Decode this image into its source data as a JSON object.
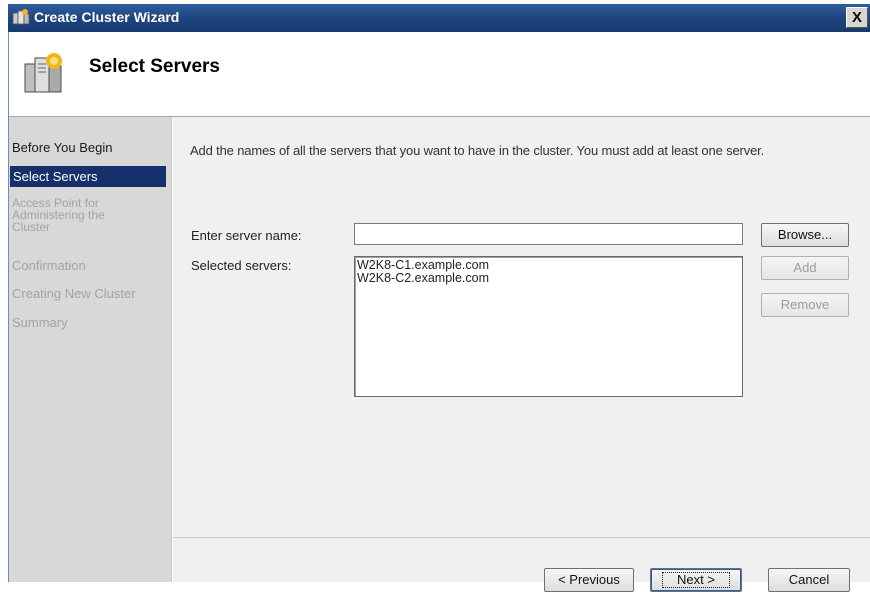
{
  "window": {
    "title": "Create Cluster Wizard",
    "close_label": "X"
  },
  "header": {
    "title": "Select Servers"
  },
  "steps": [
    {
      "label": "Before You Begin",
      "state": "done"
    },
    {
      "label": "Select Servers",
      "state": "active"
    },
    {
      "label": "Access Point for\nAdministering the\nCluster",
      "state": "pending"
    },
    {
      "label": "Confirmation",
      "state": "pending"
    },
    {
      "label": "Creating New Cluster",
      "state": "pending"
    },
    {
      "label": "Summary",
      "state": "pending"
    }
  ],
  "main": {
    "intro": "Add the names of all the servers that you want to have in the cluster. You must add at least one server.",
    "server_name_label": "Enter server name:",
    "server_name_value": "",
    "selected_servers_label": "Selected servers:",
    "selected_servers": [
      "W2K8-C1.example.com",
      "W2K8-C2.example.com"
    ],
    "browse_label": "Browse...",
    "add_label": "Add",
    "remove_label": "Remove"
  },
  "footer": {
    "previous_label": "< Previous",
    "next_label": "Next >",
    "cancel_label": "Cancel"
  },
  "colors": {
    "titlebar": "#1f4480",
    "active_step": "#16306c",
    "steps_bg": "#d8d8d8",
    "content_bg": "#f0f0f0"
  }
}
